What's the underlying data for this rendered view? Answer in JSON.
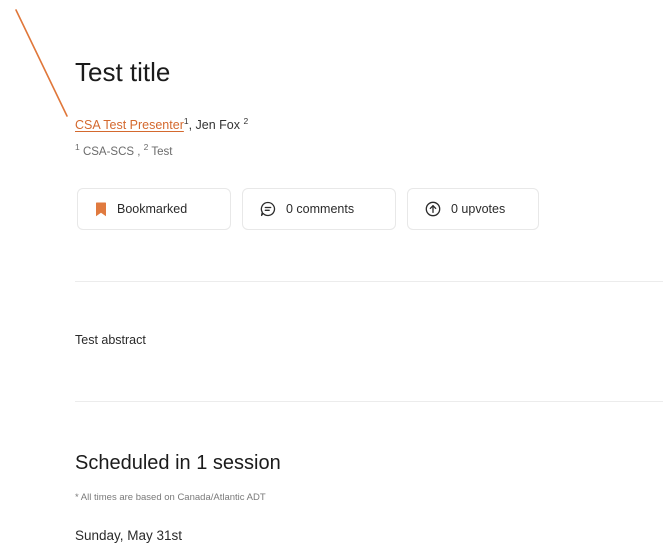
{
  "paper": {
    "title": "Test title",
    "authors": [
      {
        "name": "CSA Test Presenter",
        "affiliation_ref": "1"
      },
      {
        "name": "Jen Fox",
        "affiliation_ref": "2"
      }
    ],
    "affiliations": [
      {
        "ref": "1",
        "name": "CSA-SCS"
      },
      {
        "ref": "2",
        "name": "Test"
      }
    ],
    "abstract": "Test abstract"
  },
  "actions": {
    "bookmark_label": "Bookmarked",
    "comments_label": "0 comments",
    "upvotes_label": "0 upvotes"
  },
  "schedule": {
    "heading": "Scheduled in 1 session",
    "timezone_note": "* All times are based on Canada/Atlantic ADT",
    "date": "Sunday, May 31st"
  },
  "colors": {
    "accent": "#d4692e",
    "bookmark": "#e07a3f",
    "annotation_line": "#e0773a"
  },
  "icons": {
    "bookmark": "bookmark-icon",
    "comments": "comment-icon",
    "upvotes": "upvote-icon"
  }
}
